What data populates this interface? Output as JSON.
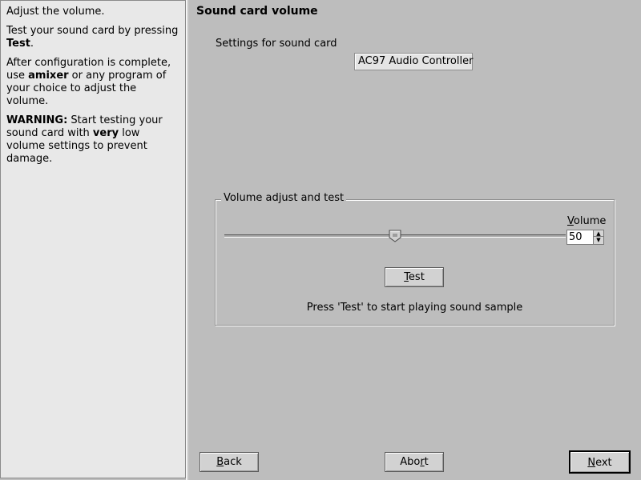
{
  "help": {
    "line1": "Adjust the volume.",
    "p2_text": "Test your sound card by pressing ",
    "p2_bold": "Test",
    "p2_end": ".",
    "p3_a": "After configuration is complete, use ",
    "p3_bold": "amixer",
    "p3_b": " or any program of your choice to adjust the volume.",
    "p4_bold1": "WARNING:",
    "p4_a": " Start testing your sound card with ",
    "p4_bold2": "very",
    "p4_b": " low volume settings to prevent damage."
  },
  "main": {
    "title": "Sound card volume",
    "settings_label": "Settings for sound card",
    "card_name": "AC97 Audio Controller"
  },
  "volume": {
    "group_title": "Volume adjust and test",
    "label_mnemonic": "V",
    "label_rest": "olume",
    "value": "50",
    "slider_percent": 50,
    "test_mnemonic": "T",
    "test_rest": "est",
    "hint": "Press 'Test' to start playing sound sample"
  },
  "buttons": {
    "back_mnemonic": "B",
    "back_rest": "ack",
    "abort_a": "Abo",
    "abort_mnemonic": "r",
    "abort_b": "t",
    "next_mnemonic": "N",
    "next_rest": "ext"
  }
}
